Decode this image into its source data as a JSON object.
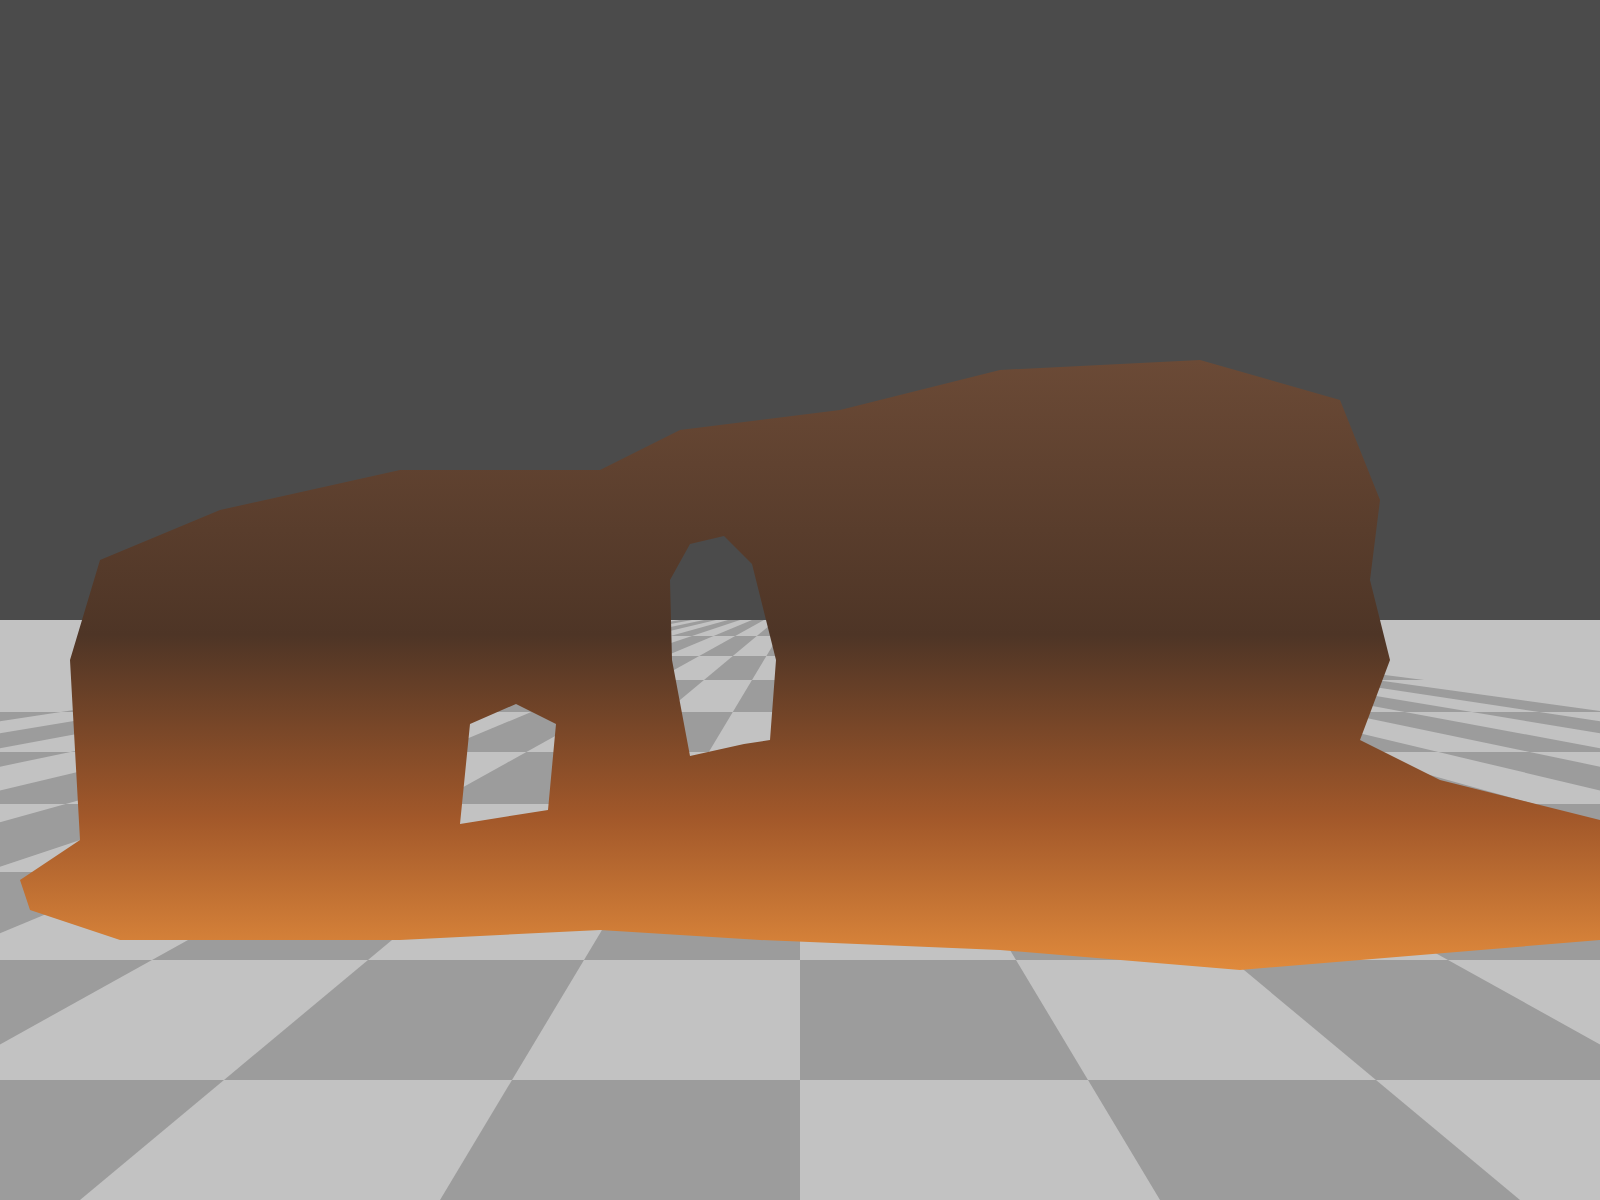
{
  "scene": {
    "kind": "render"
  }
}
